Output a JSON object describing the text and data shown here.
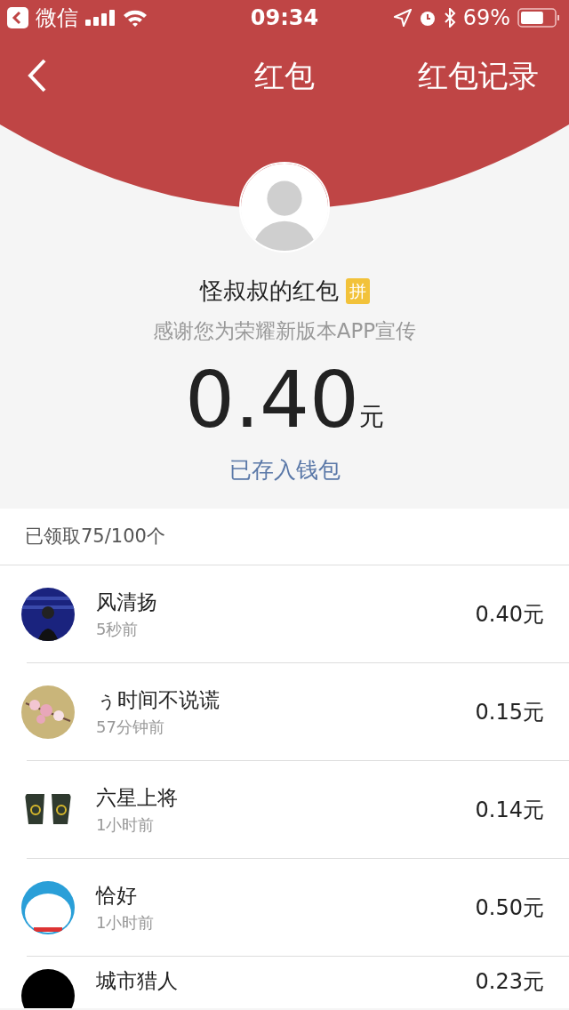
{
  "status_bar": {
    "back_app": "微信",
    "time": "09:34",
    "battery": "69%"
  },
  "nav": {
    "title": "红包",
    "right_link": "红包记录"
  },
  "packet": {
    "sender_title": "怪叔叔的红包",
    "badge": "拼",
    "message": "感谢您为荣耀新版本APP宣传",
    "amount": "0.40",
    "unit": "元",
    "status_link": "已存入钱包"
  },
  "summary": "已领取75/100个",
  "recipients": [
    {
      "name": "风清扬",
      "time": "5秒前",
      "amount": "0.40元"
    },
    {
      "name": "ぅ时间不说谎",
      "time": "57分钟前",
      "amount": "0.15元"
    },
    {
      "name": "六星上将",
      "time": "1小时前",
      "amount": "0.14元"
    },
    {
      "name": "恰好",
      "time": "1小时前",
      "amount": "0.50元"
    },
    {
      "name": "城市猎人",
      "amount": "0.23元"
    }
  ]
}
